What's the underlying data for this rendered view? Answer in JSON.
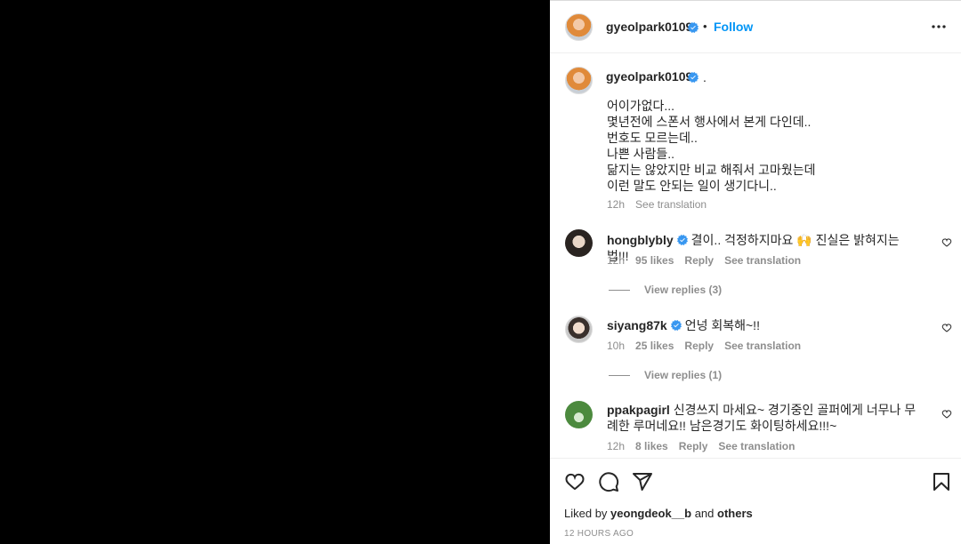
{
  "post": {
    "author": "gyeolpark0109",
    "follow_label": "Follow",
    "dot_separator": "•",
    "caption_author": "gyeolpark0109",
    "caption_suffix": ".",
    "caption_text": "어이가없다...\n몇년전에 스폰서 행사에서 본게 다인데..\n번호도 모르는데..\n나쁜 사람들..\n닮지는 않았지만 비교 해줘서 고마웠는데\n이런 말도 안되는 일이 생기다니..",
    "caption_time": "12h",
    "see_translation": "See translation"
  },
  "comments": [
    {
      "user": "hongblybly",
      "verified": true,
      "text": "결이.. 걱정하지마요 🙌 진실은 밝혀지는법!!!",
      "time": "12h",
      "likes": "95 likes",
      "reply": "Reply",
      "see_translation": "See translation",
      "view_replies": "View replies (3)"
    },
    {
      "user": "siyang87k",
      "verified": true,
      "text": "언넝 회복해~!!",
      "time": "10h",
      "likes": "25 likes",
      "reply": "Reply",
      "see_translation": "See translation",
      "view_replies": "View replies (1)"
    },
    {
      "user": "ppakpagirl",
      "verified": false,
      "text": "신경쓰지 마세요~ 경기중인 골퍼에게 너무나 무례한 루머네요!! 남은경기도 화이팅하세요!!!~",
      "time": "12h",
      "likes": "8 likes",
      "reply": "Reply",
      "see_translation": "See translation"
    }
  ],
  "footer": {
    "liked_prefix": "Liked by",
    "liked_user": "yeongdeok__b",
    "liked_and": "and",
    "liked_others": "others",
    "timestamp": "12 HOURS AGO"
  },
  "colors": {
    "accent": "#0095f6",
    "verified": "#3897f0",
    "muted": "#8e8e8e"
  },
  "icons": [
    "more-options-icon",
    "verified-badge-icon",
    "heart-icon",
    "comment-icon",
    "share-icon",
    "bookmark-icon"
  ]
}
